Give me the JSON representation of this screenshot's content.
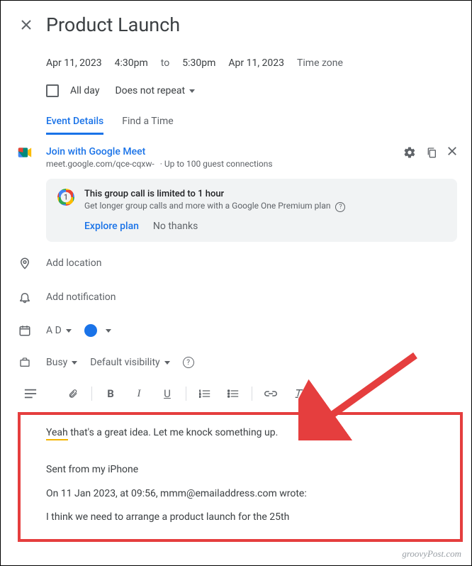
{
  "header": {
    "title": "Product Launch"
  },
  "datetime": {
    "start_date": "Apr 11, 2023",
    "start_time": "4:30pm",
    "to": "to",
    "end_time": "5:30pm",
    "end_date": "Apr 11, 2023",
    "timezone_label": "Time zone"
  },
  "allday": {
    "label": "All day",
    "recurrence": "Does not repeat"
  },
  "tabs": {
    "details": "Event Details",
    "find_time": "Find a Time"
  },
  "meet": {
    "join_label": "Join with Google Meet",
    "url": "meet.google.com/qce-cqxw-",
    "guest_limit": "Up to 100 guest connections"
  },
  "one_promo": {
    "title": "This group call is limited to 1 hour",
    "subtitle": "Get longer group calls and more with a Google One Premium plan",
    "explore": "Explore plan",
    "no_thanks": "No thanks"
  },
  "location": {
    "placeholder": "Add location"
  },
  "notification": {
    "placeholder": "Add notification"
  },
  "calendar": {
    "owner": "A D"
  },
  "availability": {
    "busy": "Busy",
    "visibility": "Default visibility"
  },
  "description": {
    "line1_underlined": "Yeah",
    "line1_rest": " that's a great idea. Let me knock something up.",
    "signature": "Sent from my iPhone",
    "quote_header": "On 11 Jan 2023, at 09:56, mmm@emailaddress.com wrote:",
    "quote_body": "I think we need to arrange a product launch for the 25th"
  },
  "watermark": "groovyPost.com"
}
